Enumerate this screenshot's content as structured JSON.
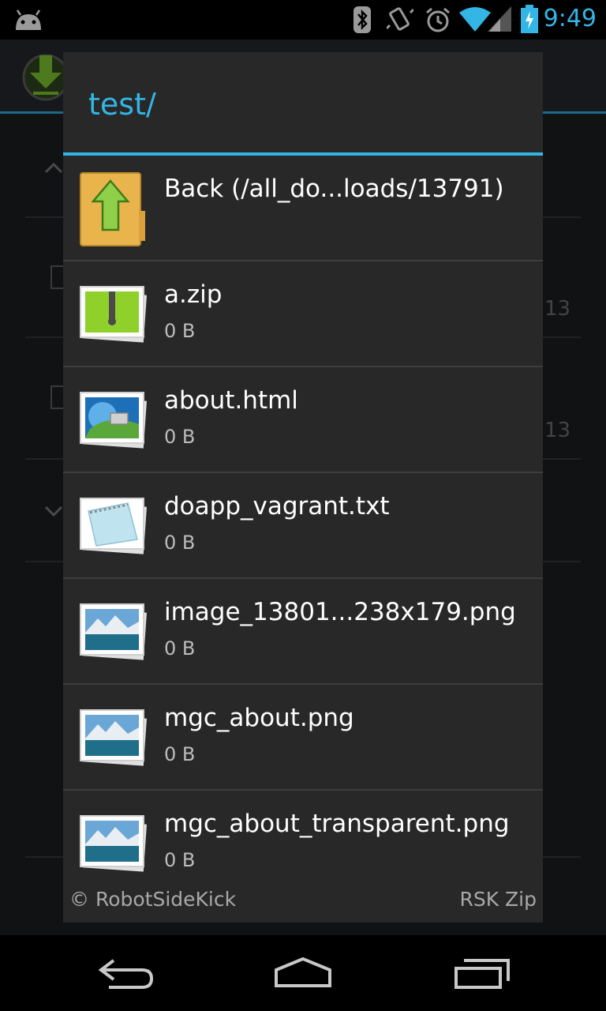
{
  "status_bar": {
    "time": "9:49",
    "icons": [
      "android-icon",
      "bluetooth-icon",
      "vibrate-icon",
      "alarm-icon",
      "wifi-icon",
      "signal-icon",
      "battery-icon"
    ]
  },
  "background": {
    "numbers": [
      "13",
      "13"
    ]
  },
  "dialog": {
    "title": "test/",
    "items": [
      {
        "name": "Back (/all_do...loads/13791)",
        "size": "",
        "icon": "folder-up-icon"
      },
      {
        "name": "a.zip",
        "size": "0 B",
        "icon": "zip-file-icon"
      },
      {
        "name": "about.html",
        "size": "0 B",
        "icon": "html-file-icon"
      },
      {
        "name": "doapp_vagrant.txt",
        "size": "0 B",
        "icon": "text-file-icon"
      },
      {
        "name": "image_13801...238x179.png",
        "size": "0 B",
        "icon": "image-file-icon"
      },
      {
        "name": "mgc_about.png",
        "size": "0 B",
        "icon": "image-file-icon"
      },
      {
        "name": "mgc_about_transparent.png",
        "size": "0 B",
        "icon": "image-file-icon"
      }
    ],
    "footer_left": "© RobotSideKick",
    "footer_right": "RSK Zip"
  },
  "colors": {
    "accent": "#33b5e5",
    "dialog_bg": "#282828",
    "divider": "#3e3e3e"
  }
}
